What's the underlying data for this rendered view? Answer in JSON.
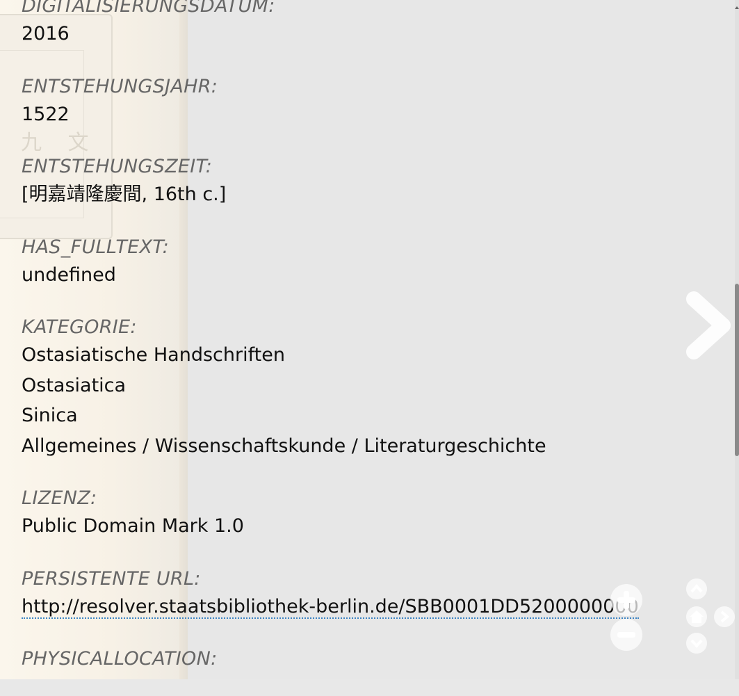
{
  "metadata": [
    {
      "label": "DIGITALISIERUNGSDATUM:",
      "values": [
        "2016"
      ]
    },
    {
      "label": "ENTSTEHUNGSJAHR:",
      "values": [
        "1522"
      ]
    },
    {
      "label": "ENTSTEHUNGSZEIT:",
      "values": [
        "[明嘉靖隆慶間, 16th c.]"
      ]
    },
    {
      "label": "HAS_FULLTEXT:",
      "values": [
        "undefined"
      ]
    },
    {
      "label": "KATEGORIE:",
      "values": [
        "Ostasiatische Handschriften",
        "Ostasiatica",
        "Sinica",
        "Allgemeines / Wissenschaftskunde / Literaturgeschichte"
      ]
    },
    {
      "label": "LIZENZ:",
      "values": [
        "Public Domain Mark 1.0"
      ]
    },
    {
      "label": "PERSISTENTE URL:",
      "link": "http://resolver.staatsbibliothek-berlin.de/SBB0001DD5200000000"
    },
    {
      "label": "PHYSICALLOCATION:"
    }
  ],
  "scan_chars": "九 文",
  "icons": {
    "next": "chevron-right-icon",
    "zoom_in": "plus-icon",
    "zoom_out": "minus-icon",
    "pan_up": "chevron-up-icon",
    "pan_down": "chevron-down-icon",
    "home": "home-icon",
    "pan_right": "chevron-right-icon"
  },
  "colors": {
    "label": "#666666",
    "value": "#111111",
    "link_underline": "#3a83c4",
    "overlay": "#e7e7e7"
  }
}
